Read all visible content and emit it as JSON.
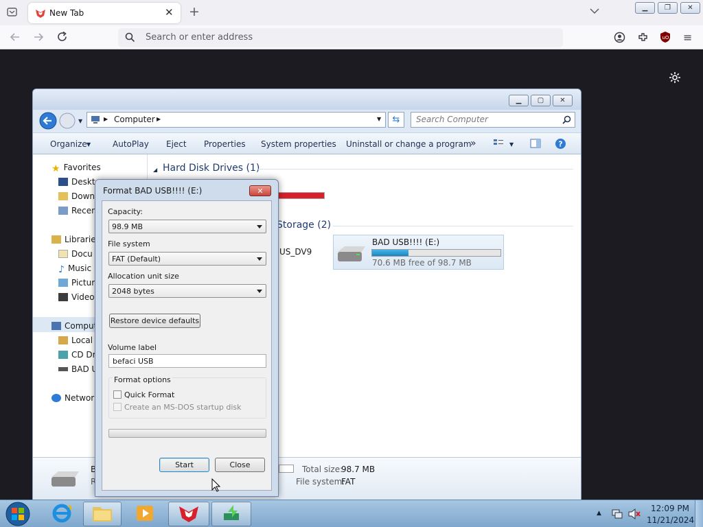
{
  "browser": {
    "tab_title": "New Tab",
    "url_placeholder": "Search or enter address"
  },
  "explorer": {
    "breadcrumb": "Computer",
    "search_placeholder": "Search Computer",
    "toolbar": {
      "organize": "Organize",
      "autoplay": "AutoPlay",
      "eject": "Eject",
      "properties": "Properties",
      "system_properties": "System properties",
      "uninstall": "Uninstall or change a program",
      "more": "»"
    },
    "nav": {
      "favorites": "Favorites",
      "desktop": "Deskto",
      "downloads": "Down",
      "recent": "Recen",
      "libraries": "Libraries",
      "documents": "Docu",
      "music": "Music",
      "pictures": "Pictur",
      "videos": "Video",
      "computer": "Comput",
      "local_disk": "Local",
      "cd_drive": "CD Dr",
      "bad_usb": "BAD U",
      "network": "Network"
    },
    "sections": {
      "hard_disks": "Hard Disk Drives (1)",
      "removable": "Storage (2)",
      "other_drive_label": "US_DV9"
    },
    "usb_drive": {
      "name": "BAD USB!!!! (E:)",
      "free_text": "70.6 MB free of 98.7 MB",
      "used_fraction": 0.285
    },
    "details": {
      "name_initial": "B",
      "sub_initial": "R",
      "total_size_label": "Total size:",
      "total_size_value": "98.7 MB",
      "fs_label": "File system:",
      "fs_value": "FAT"
    }
  },
  "format_dialog": {
    "title": "Format BAD USB!!!! (E:)",
    "capacity_label": "Capacity:",
    "capacity_value": "98.9 MB",
    "filesystem_label": "File system",
    "filesystem_value": "FAT (Default)",
    "allocation_label": "Allocation unit size",
    "allocation_value": "2048 bytes",
    "restore_button": "Restore device defaults",
    "volume_label": "Volume label",
    "volume_value": "befaci USB",
    "format_options_label": "Format options",
    "quick_format": "Quick Format",
    "msdos_disk": "Create an MS-DOS startup disk",
    "start_button": "Start",
    "close_button": "Close"
  },
  "taskbar": {
    "time": "12:09 PM",
    "date": "11/21/2024"
  },
  "colors": {
    "accent_blue": "#2d7bd6",
    "hard_disk_bar": "#d8202a",
    "usb_bar": "#26a0da",
    "close_red": "#c8463c"
  }
}
